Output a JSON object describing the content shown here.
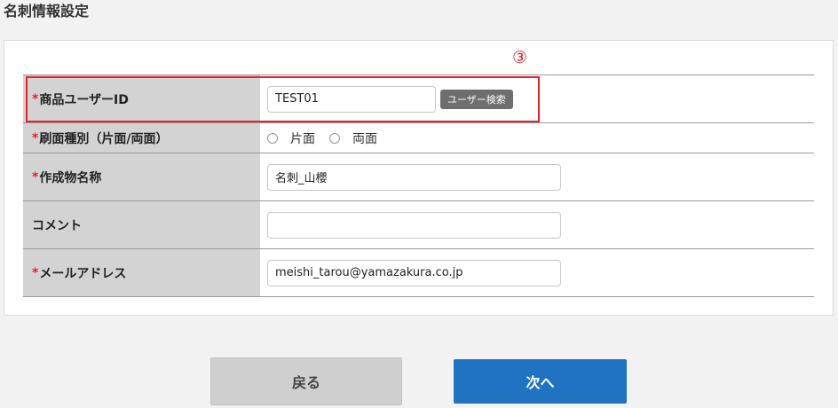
{
  "page": {
    "title": "名刺情報設定"
  },
  "annotation": {
    "number": "③",
    "color": "#e0252b"
  },
  "form": {
    "required_mark": "*",
    "rows": [
      {
        "label": "商品ユーザーID",
        "required": true,
        "type": "text",
        "value": "TEST01",
        "button_label": "ユーザー検索"
      },
      {
        "label": "刷面種別（片面/両面）",
        "required": true,
        "type": "radio",
        "options": [
          "片面",
          "両面"
        ],
        "selected": null
      },
      {
        "label": "作成物名称",
        "required": true,
        "type": "text",
        "value": "名刺_山櫻"
      },
      {
        "label": "コメント",
        "required": false,
        "type": "text",
        "value": ""
      },
      {
        "label": "メールアドレス",
        "required": true,
        "type": "text",
        "value": "meishi_tarou@yamazakura.co.jp"
      }
    ]
  },
  "actions": {
    "back_label": "戻る",
    "next_label": "次へ"
  },
  "colors": {
    "accent": "#1f73c1",
    "required": "#e0252b",
    "label_bg": "#d3d3d3",
    "search_button": "#6e6e6e"
  }
}
